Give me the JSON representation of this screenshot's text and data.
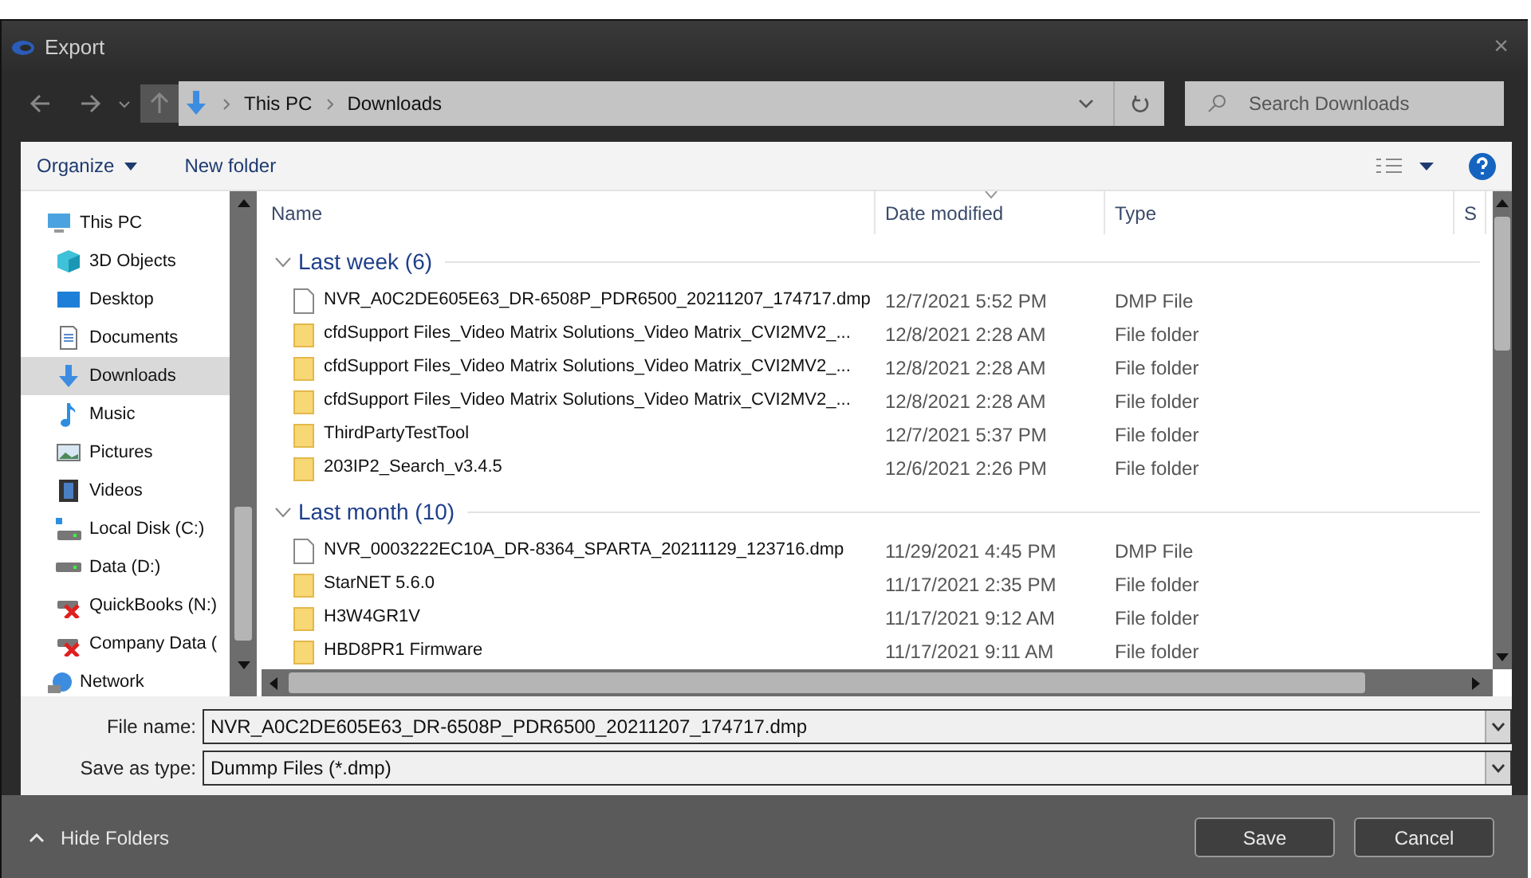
{
  "window": {
    "title": "Export",
    "close": "×"
  },
  "nav": {
    "breadcrumb": [
      "This PC",
      "Downloads"
    ],
    "search": {
      "placeholder": "Search Downloads"
    }
  },
  "toolbar": {
    "buttons": [
      "Organize",
      "New folder"
    ]
  },
  "sidebar": {
    "items": [
      {
        "label": "This PC",
        "kind": "pc",
        "selected": false,
        "children": [
          {
            "label": "3D Objects",
            "kind": "objects",
            "selected": false
          },
          {
            "label": "Desktop",
            "kind": "desktop",
            "selected": false
          },
          {
            "label": "Documents",
            "kind": "documents",
            "selected": false
          },
          {
            "label": "Downloads",
            "kind": "downloads",
            "selected": true
          },
          {
            "label": "Music",
            "kind": "music",
            "selected": false
          },
          {
            "label": "Pictures",
            "kind": "pictures",
            "selected": false
          },
          {
            "label": "Videos",
            "kind": "videos",
            "selected": false
          },
          {
            "label": "Local Disk (C:)",
            "kind": "disk",
            "selected": false
          },
          {
            "label": "Data (D:)",
            "kind": "drive",
            "selected": false
          },
          {
            "label": "QuickBooks (N:)",
            "kind": "netdrive",
            "selected": false
          },
          {
            "label": "Company Data (",
            "kind": "netdrive",
            "selected": false
          }
        ]
      },
      {
        "label": "Network",
        "kind": "network",
        "selected": false
      }
    ]
  },
  "table": {
    "columns": [
      {
        "label": "Name",
        "sorted": false
      },
      {
        "label": "Date modified",
        "sorted": true
      },
      {
        "label": "Type",
        "sorted": false
      },
      {
        "label": "S",
        "sorted": false
      }
    ],
    "groups": [
      {
        "label": "Last week (6)",
        "expanded": true,
        "rows": [
          {
            "name": "NVR_A0C2DE605E63_DR-6508P_PDR6500_20211207_174717.dmp",
            "date": "12/7/2021 5:52 PM",
            "type": "DMP File",
            "kind": "file"
          },
          {
            "name": "cfdSupport Files_Video Matrix Solutions_Video Matrix_CVI2MV2_...",
            "date": "12/8/2021 2:28 AM",
            "type": "File folder",
            "kind": "folder"
          },
          {
            "name": "cfdSupport Files_Video Matrix Solutions_Video Matrix_CVI2MV2_...",
            "date": "12/8/2021 2:28 AM",
            "type": "File folder",
            "kind": "folder"
          },
          {
            "name": "cfdSupport Files_Video Matrix Solutions_Video Matrix_CVI2MV2_...",
            "date": "12/8/2021 2:28 AM",
            "type": "File folder",
            "kind": "folder"
          },
          {
            "name": "ThirdPartyTestTool",
            "date": "12/7/2021 5:37 PM",
            "type": "File folder",
            "kind": "folder"
          },
          {
            "name": "203IP2_Search_v3.4.5",
            "date": "12/6/2021 2:26 PM",
            "type": "File folder",
            "kind": "folder"
          }
        ]
      },
      {
        "label": "Last month (10)",
        "expanded": true,
        "rows": [
          {
            "name": "NVR_0003222EC10A_DR-8364_SPARTA_20211129_123716.dmp",
            "date": "11/29/2021 4:45 PM",
            "type": "DMP File",
            "kind": "file"
          },
          {
            "name": "StarNET 5.6.0",
            "date": "11/17/2021 2:35 PM",
            "type": "File folder",
            "kind": "folder"
          },
          {
            "name": "H3W4GR1V",
            "date": "11/17/2021 9:12 AM",
            "type": "File folder",
            "kind": "folder"
          },
          {
            "name": "HBD8PR1 Firmware",
            "date": "11/17/2021 9:11 AM",
            "type": "File folder",
            "kind": "folder"
          }
        ]
      }
    ]
  },
  "form": {
    "file_name": {
      "label": "File name:",
      "value": "NVR_A0C2DE605E63_DR-6508P_PDR6500_20211207_174717.dmp"
    },
    "save_as_type": {
      "label": "Save as type:",
      "value": "Dummp Files (*.dmp)"
    }
  },
  "footer": {
    "hide_folders": "Hide Folders",
    "buttons": [
      "Save",
      "Cancel"
    ]
  }
}
